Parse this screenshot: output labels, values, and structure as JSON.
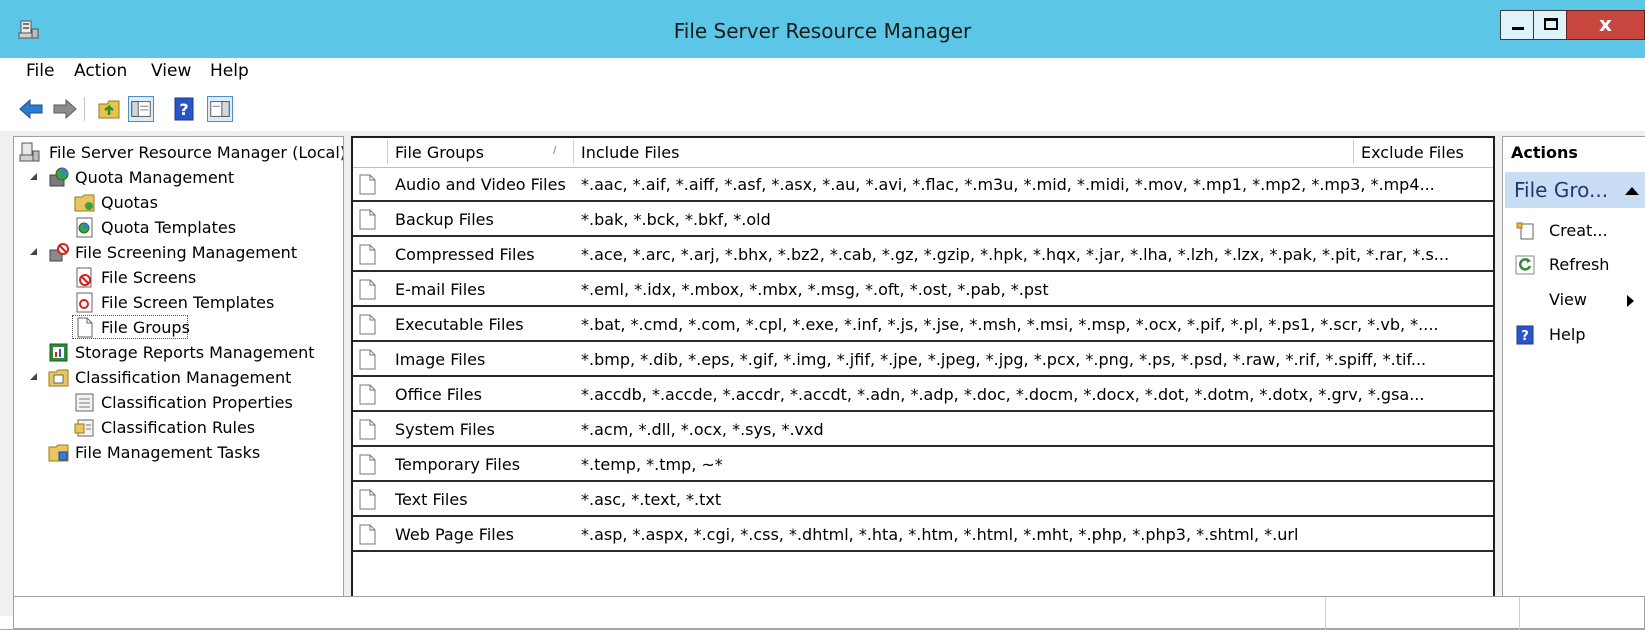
{
  "window": {
    "title": "File Server Resource Manager",
    "close_glyph": "x",
    "accent_color": "#5cc6e6"
  },
  "menu": {
    "items": [
      "File",
      "Action",
      "View",
      "Help"
    ]
  },
  "toolbar": {
    "icons": [
      "back-arrow-icon",
      "forward-arrow-icon",
      "up-folder-icon",
      "show-hide-tree-icon",
      "help-icon",
      "action-pane-icon"
    ]
  },
  "tree": {
    "items": [
      {
        "label": "File Server Resource Manager (Local)",
        "icon": "server-icon"
      },
      {
        "label": "Quota Management",
        "icon": "quota-icon",
        "expanded": true
      },
      {
        "label": "Quotas",
        "icon": "folder-icon"
      },
      {
        "label": "Quota Templates",
        "icon": "template-icon"
      },
      {
        "label": "File Screening Management",
        "icon": "screening-icon",
        "expanded": true
      },
      {
        "label": "File Screens",
        "icon": "file-screen-icon"
      },
      {
        "label": "File Screen Templates",
        "icon": "screen-template-icon"
      },
      {
        "label": "File Groups",
        "icon": "file-icon",
        "selected": true
      },
      {
        "label": "Storage Reports Management",
        "icon": "reports-icon"
      },
      {
        "label": "Classification Management",
        "icon": "classification-icon",
        "expanded": true
      },
      {
        "label": "Classification Properties",
        "icon": "properties-icon"
      },
      {
        "label": "Classification Rules",
        "icon": "rules-icon"
      },
      {
        "label": "File Management Tasks",
        "icon": "tasks-icon"
      }
    ]
  },
  "list": {
    "columns": {
      "name": "File Groups",
      "include": "Include Files",
      "exclude": "Exclude Files"
    },
    "rows": [
      {
        "name": "Audio and Video Files",
        "include": "*.aac, *.aif, *.aiff, *.asf, *.asx, *.au, *.avi, *.flac, *.m3u, *.mid, *.midi, *.mov, *.mp1, *.mp2, *.mp3, *.mp4...",
        "exclude": ""
      },
      {
        "name": "Backup Files",
        "include": "*.bak, *.bck, *.bkf, *.old",
        "exclude": ""
      },
      {
        "name": "Compressed Files",
        "include": "*.ace, *.arc, *.arj, *.bhx, *.bz2, *.cab, *.gz, *.gzip, *.hpk, *.hqx, *.jar, *.lha, *.lzh, *.lzx, *.pak, *.pit, *.rar, *.s...",
        "exclude": ""
      },
      {
        "name": "E-mail Files",
        "include": "*.eml, *.idx, *.mbox, *.mbx, *.msg, *.oft, *.ost, *.pab, *.pst",
        "exclude": ""
      },
      {
        "name": "Executable Files",
        "include": "*.bat, *.cmd, *.com, *.cpl, *.exe, *.inf, *.js, *.jse, *.msh, *.msi, *.msp, *.ocx, *.pif, *.pl, *.ps1, *.scr, *.vb, *....",
        "exclude": ""
      },
      {
        "name": "Image Files",
        "include": "*.bmp, *.dib, *.eps, *.gif, *.img, *.jfif, *.jpe, *.jpeg, *.jpg, *.pcx, *.png, *.ps, *.psd, *.raw, *.rif, *.spiff, *.tif...",
        "exclude": ""
      },
      {
        "name": "Office Files",
        "include": "*.accdb, *.accde, *.accdr, *.accdt, *.adn, *.adp, *.doc, *.docm, *.docx, *.dot, *.dotm, *.dotx, *.grv, *.gsa...",
        "exclude": ""
      },
      {
        "name": "System Files",
        "include": "*.acm, *.dll, *.ocx, *.sys, *.vxd",
        "exclude": ""
      },
      {
        "name": "Temporary Files",
        "include": "*.temp, *.tmp, ~*",
        "exclude": ""
      },
      {
        "name": "Text Files",
        "include": "*.asc, *.text, *.txt",
        "exclude": ""
      },
      {
        "name": "Web Page Files",
        "include": "*.asp, *.aspx, *.cgi, *.css, *.dhtml, *.hta, *.htm, *.html, *.mht, *.php, *.php3, *.shtml, *.url",
        "exclude": ""
      }
    ]
  },
  "actions": {
    "title": "Actions",
    "section": "File Gro...",
    "items": [
      {
        "label": "Creat...",
        "icon": "create-icon"
      },
      {
        "label": "Refresh",
        "icon": "refresh-icon"
      },
      {
        "label": "View",
        "icon": "",
        "submenu": true
      },
      {
        "label": "Help",
        "icon": "help-icon"
      }
    ]
  }
}
